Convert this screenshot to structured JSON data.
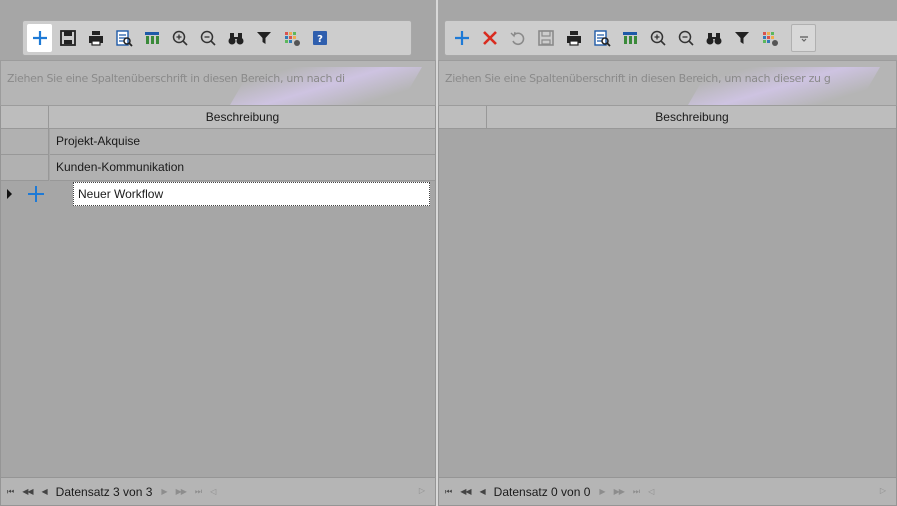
{
  "left": {
    "toolbar": {
      "icons": [
        "add-icon",
        "save-icon",
        "print-icon",
        "preview-icon",
        "columns-icon",
        "zoom-in-icon",
        "zoom-out-icon",
        "find-icon",
        "filter-icon",
        "layout-icon",
        "help-icon"
      ]
    },
    "group_panel_hint": "Ziehen Sie eine Spaltenüberschrift in diesen Bereich, um nach di",
    "column_header": "Beschreibung",
    "rows": [
      {
        "label": "Projekt-Akquise"
      },
      {
        "label": "Kunden-Kommunikation"
      }
    ],
    "new_row": {
      "value": "Neuer Workflow"
    },
    "navigator": {
      "first": "⏮",
      "prev_page": "◀◀",
      "prev": "◀",
      "status": "Datensatz 3 von 3",
      "next": "▶",
      "next_page": "▶▶",
      "last": "⏭",
      "append": "◁",
      "end": "▷"
    }
  },
  "right": {
    "toolbar": {
      "icons": [
        "add-icon",
        "delete-icon",
        "undo-icon",
        "save-icon",
        "print-icon",
        "preview-icon",
        "columns-icon",
        "zoom-in-icon",
        "zoom-out-icon",
        "find-icon",
        "filter-icon",
        "layout-icon",
        "more-icon"
      ]
    },
    "group_panel_hint": "Ziehen Sie eine Spaltenüberschrift in diesen Bereich, um nach dieser zu g",
    "column_header": "Beschreibung",
    "navigator": {
      "first": "⏮",
      "prev_page": "◀◀",
      "prev": "◀",
      "status": "Datensatz 0 von 0",
      "next": "▶",
      "next_page": "▶▶",
      "last": "⏭",
      "append": "◁",
      "end": "▷"
    }
  },
  "colors": {
    "accent_blue": "#1e7ad6",
    "delete_red": "#d92b1f",
    "background": "#a6a6a6"
  }
}
